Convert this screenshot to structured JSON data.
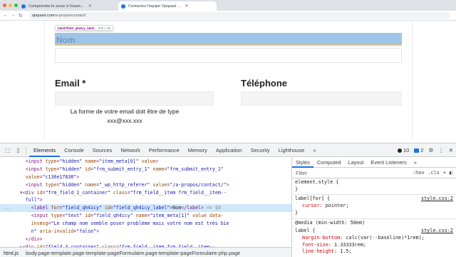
{
  "browser": {
    "tabs": [
      {
        "title": "Comprendre le score à l'exam...",
        "active": false
      },
      {
        "title": "Contactez l'équipe Opquast ...",
        "active": true
      }
    ],
    "url_host": "opquast.com",
    "url_path": "/a-propos/contact/"
  },
  "page": {
    "tooltip_selector": "label#field_qh4icy_label",
    "tooltip_size": "976 × 26",
    "nom_label": "Nom",
    "email_label": "Email *",
    "telephone_label": "Téléphone",
    "error_line1": "La forme de votre email doit être de type",
    "error_line2": "xxx@xxx.xxx"
  },
  "devtools": {
    "tabs": [
      "Elements",
      "Console",
      "Sources",
      "Network",
      "Performance",
      "Memory",
      "Application",
      "Security",
      "Lighthouse"
    ],
    "active_tab": "Elements",
    "more": "»",
    "issues_count": "10",
    "messages_count": "2",
    "styles_tabs": [
      "Styles",
      "Computed",
      "Layout",
      "Event Listeners",
      "»"
    ],
    "filter_placeholder": "Filter",
    "filter_hov": ":hov",
    "filter_cls": ".cls",
    "breadcrumb": [
      "html.js",
      "body.page-template.page-template-pageFormulaire.page-template-pageFormulaire-php.page"
    ]
  }
}
